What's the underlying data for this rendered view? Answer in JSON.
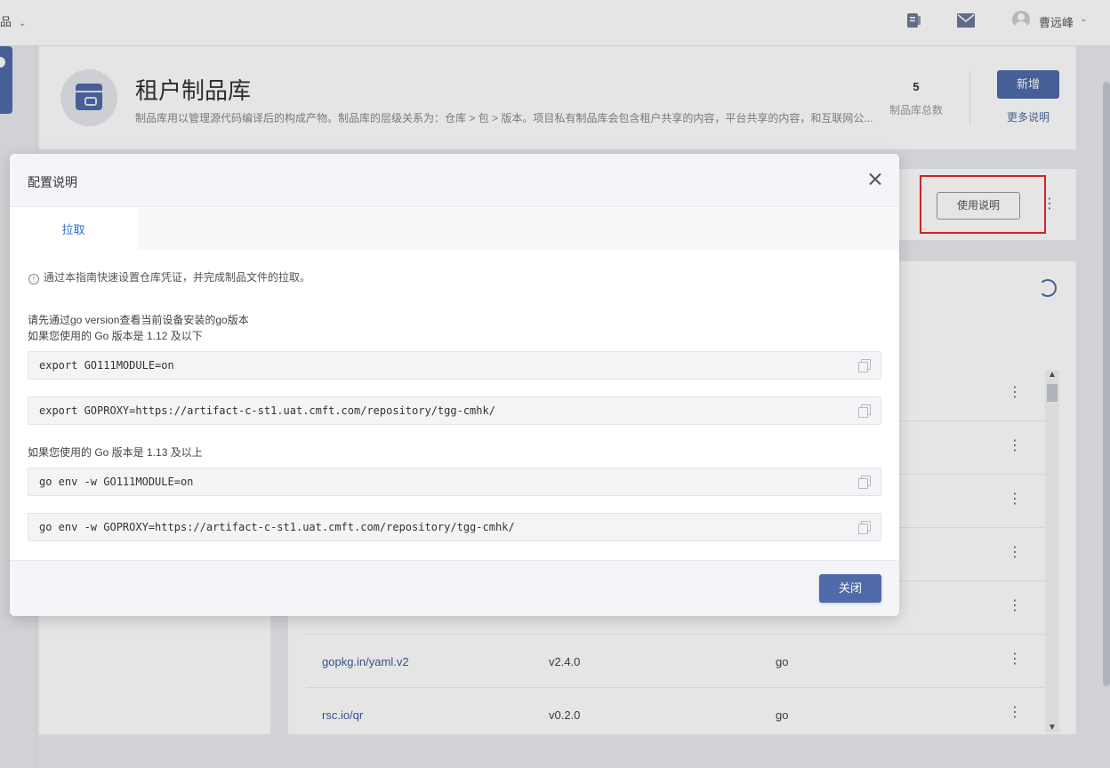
{
  "topbar": {
    "left_label": "品",
    "user_name": "曹远峰",
    "icons": [
      "document-icon",
      "mail-icon",
      "user-avatar-icon",
      "chevron-down-icon"
    ]
  },
  "header": {
    "title": "租户制品库",
    "description": "制品库用以管理源代码编译后的构成产物。制品库的层级关系为：仓库 > 包 > 版本。项目私有制品库会包含租户共享的内容，平台共享的内容，和互联网公...",
    "repo_count": "5",
    "repo_count_label": "制品库总数",
    "new_button": "新增",
    "more_link": "更多说明"
  },
  "toolbar": {
    "usage_button": "使用说明"
  },
  "table": {
    "rows": [
      {
        "name": "gopkg.in/yaml.v2",
        "version": "v2.4.0",
        "type": "go"
      },
      {
        "name": "rsc.io/qr",
        "version": "v0.2.0",
        "type": "go"
      }
    ]
  },
  "modal": {
    "title": "配置说明",
    "tab": "拉取",
    "tip": "通过本指南快速设置仓库凭证，并完成制品文件的拉取。",
    "intro_line1": "请先通过go version查看当前设备安装的go版本",
    "intro_line2": "如果您使用的 Go 版本是 1.12 及以下",
    "code1": "export GO111MODULE=on",
    "code2": "export GOPROXY=https://artifact-c-st1.uat.cmft.com/repository/tgg-cmhk/",
    "intro_line3": "如果您使用的 Go 版本是 1.13 及以上",
    "code3": "go env -w GO111MODULE=on",
    "code4": "go env -w GOPROXY=https://artifact-c-st1.uat.cmft.com/repository/tgg-cmhk/",
    "close_button": "关闭"
  },
  "colors": {
    "primary": "#4e6aa8",
    "tab_active": "#2f6fd1",
    "highlight_frame": "#e8272a"
  }
}
